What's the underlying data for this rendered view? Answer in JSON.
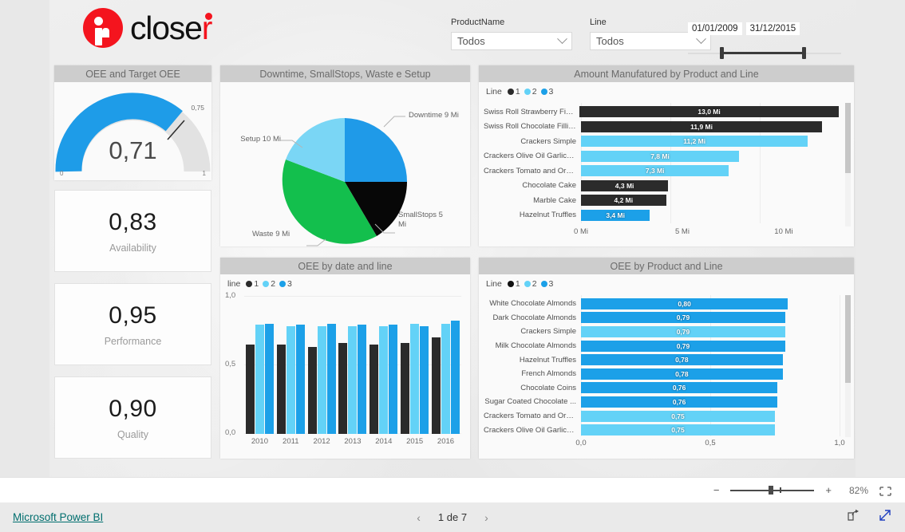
{
  "header": {
    "logo_text_left": "close",
    "logo_text_accent": "r",
    "logo_icon": "closer-person-icon"
  },
  "filters": {
    "product": {
      "label": "ProductName",
      "value": "Todos"
    },
    "line": {
      "label": "Line",
      "value": "Todos"
    },
    "date_range": {
      "start": "01/01/2009",
      "end": "31/12/2015"
    }
  },
  "panels": {
    "gauge": {
      "title": "OEE and Target OEE"
    },
    "pie": {
      "title": "Downtime, SmallStops, Waste e Setup"
    },
    "amount": {
      "title": "Amount Manufatured by Product and Line"
    },
    "oee_date": {
      "title": "OEE by date and line"
    },
    "oee_product": {
      "title": "OEE by Product and Line"
    }
  },
  "kpis": [
    {
      "value": "0,83",
      "caption": "Availability"
    },
    {
      "value": "0,95",
      "caption": "Performance"
    },
    {
      "value": "0,90",
      "caption": "Quality"
    }
  ],
  "legend_amount": {
    "title": "Line",
    "items": [
      "1",
      "2",
      "3"
    ]
  },
  "legend_date": {
    "title": "line",
    "items": [
      "1",
      "2",
      "3"
    ]
  },
  "legend_product": {
    "title": "Line",
    "items": [
      "1",
      "2",
      "3"
    ]
  },
  "colors": {
    "line1": "#2b2b2b",
    "line2": "#63d2f7",
    "line3": "#1ca0e8",
    "green": "#13bf4d",
    "accent_blue": "#1e9ce8",
    "gauge_rest": "#e2e2e2",
    "brand_red": "#f4141e",
    "link_teal": "#006e6e"
  },
  "footer": {
    "brand": "Microsoft Power BI",
    "page_text": "1 de 7",
    "prev_icon": "chevron-left-icon",
    "next_icon": "chevron-right-icon",
    "share_icon": "share-icon",
    "fullscreen_icon": "fullscreen-icon"
  },
  "zoombar": {
    "minus": "−",
    "plus": "+",
    "percent": "82%",
    "fit_icon": "fit-to-page-icon"
  },
  "chart_data": [
    {
      "type": "gauge",
      "title": "OEE and Target OEE",
      "value": 0.71,
      "value_label": "0,71",
      "target": 0.75,
      "target_label": "0,75",
      "min": 0,
      "max": 1,
      "min_label": "0",
      "max_label": "1"
    },
    {
      "type": "pie",
      "title": "Downtime, SmallStops, Waste e Setup",
      "labels": [
        "Downtime 9 Mi",
        "SmallStops 5 Mi",
        "Waste 9 Mi",
        "Setup 10 Mi"
      ],
      "slice_names": [
        "Downtime",
        "SmallStops",
        "Waste",
        "Setup"
      ],
      "values": [
        9,
        5,
        9,
        10
      ],
      "unit": "Mi",
      "colors": [
        "#1f9ae8",
        "#050505",
        "#13bf4d",
        "#7ad6f5"
      ],
      "legend": "labels-outside"
    },
    {
      "type": "bar",
      "orientation": "horizontal",
      "title": "Amount Manufatured by Product and Line",
      "legend_title": "Line",
      "legend": [
        "1",
        "2",
        "3"
      ],
      "xlabel": "",
      "ylabel": "",
      "xlim": [
        0,
        12.8
      ],
      "xticks": [
        "0 Mi",
        "5 Mi",
        "10 Mi"
      ],
      "xtick_values": [
        0,
        5,
        10
      ],
      "categories": [
        "Swiss Roll Strawberry Filling",
        "Swiss Roll Chocolate Filling",
        "Crackers Simple",
        "Crackers Olive Oil Garlic a...",
        "Crackers Tomato and Ore...",
        "Chocolate Cake",
        "Marble Cake",
        "Hazelnut Truffles"
      ],
      "values": [
        13.0,
        11.9,
        11.2,
        7.8,
        7.3,
        4.3,
        4.2,
        3.4
      ],
      "value_labels": [
        "13,0 Mi",
        "11,9 Mi",
        "11,2 Mi",
        "7,8 Mi",
        "7,3 Mi",
        "4,3 Mi",
        "4,2 Mi",
        "3,4 Mi"
      ],
      "series_line": [
        1,
        1,
        2,
        2,
        2,
        1,
        1,
        3
      ],
      "bar_colors": [
        "#2b2b2b",
        "#2b2b2b",
        "#63d2f7",
        "#63d2f7",
        "#63d2f7",
        "#2b2b2b",
        "#2b2b2b",
        "#1ca0e8"
      ]
    },
    {
      "type": "bar",
      "orientation": "vertical",
      "title": "OEE by date and line",
      "legend_title": "line",
      "categories": [
        "2010",
        "2011",
        "2012",
        "2013",
        "2014",
        "2015",
        "2016"
      ],
      "ylim": [
        0,
        1
      ],
      "yticks": [
        "0,0",
        "0,5",
        "1,0"
      ],
      "ytick_values": [
        0,
        0.5,
        1.0
      ],
      "series": [
        {
          "name": "1",
          "color": "#2b2b2b",
          "values": [
            0.65,
            0.65,
            0.63,
            0.66,
            0.65,
            0.66,
            0.7
          ]
        },
        {
          "name": "2",
          "color": "#63d2f7",
          "values": [
            0.79,
            0.78,
            0.78,
            0.78,
            0.78,
            0.8,
            0.8
          ]
        },
        {
          "name": "3",
          "color": "#1ca0e8",
          "values": [
            0.8,
            0.79,
            0.8,
            0.79,
            0.79,
            0.78,
            0.82
          ]
        }
      ]
    },
    {
      "type": "bar",
      "orientation": "horizontal",
      "title": "OEE by Product and Line",
      "legend_title": "Line",
      "legend": [
        "1",
        "2",
        "3"
      ],
      "xlim": [
        0,
        1
      ],
      "xticks": [
        "0,0",
        "0,5",
        "1,0"
      ],
      "xtick_values": [
        0,
        0.5,
        1.0
      ],
      "categories": [
        "White Chocolate Almonds",
        "Dark Chocolate Almonds",
        "Crackers Simple",
        "Milk Chocolate Almonds",
        "Hazelnut Truffles",
        "French Almonds",
        "Chocolate Coins",
        "Sugar Coated Chocolate ...",
        "Crackers Tomato and Ore...",
        "Crackers Olive Oil Garlic a..."
      ],
      "values": [
        0.8,
        0.79,
        0.79,
        0.79,
        0.78,
        0.78,
        0.76,
        0.76,
        0.75,
        0.75
      ],
      "value_labels": [
        "0,80",
        "0,79",
        "0,79",
        "0,79",
        "0,78",
        "0,78",
        "0,76",
        "0,76",
        "0,75",
        "0,75"
      ],
      "series_line": [
        3,
        3,
        2,
        3,
        3,
        3,
        3,
        3,
        2,
        2
      ],
      "bar_colors": [
        "#1ca0e8",
        "#1ca0e8",
        "#63d2f7",
        "#1ca0e8",
        "#1ca0e8",
        "#1ca0e8",
        "#1ca0e8",
        "#1ca0e8",
        "#63d2f7",
        "#63d2f7"
      ]
    }
  ]
}
